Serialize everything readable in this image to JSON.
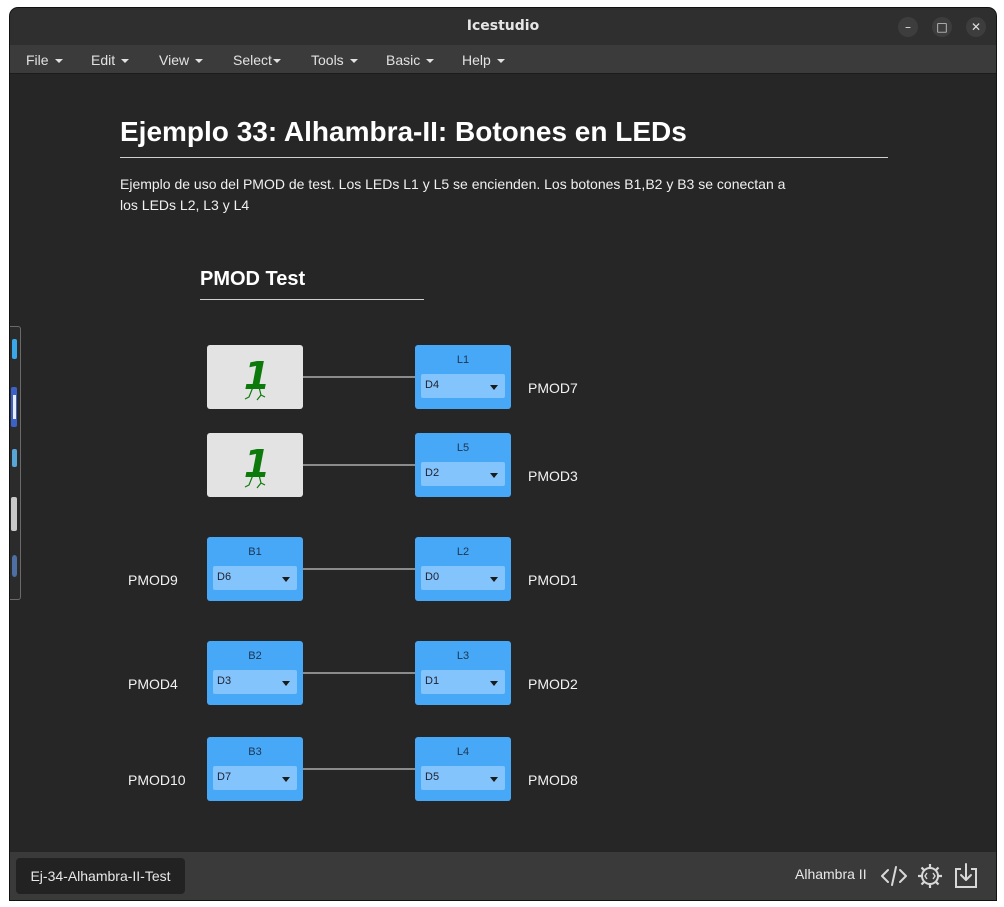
{
  "window": {
    "title": "Icestudio"
  },
  "menubar": {
    "items": [
      "File",
      "Edit",
      "View",
      "Select",
      "Tools",
      "Basic",
      "Help"
    ]
  },
  "doc": {
    "title": "Ejemplo 33: Alhambra-II: Botones en LEDs",
    "description": "Ejemplo de uso del PMOD de test. Los LEDs L1 y L5 se encienden. Los botones B1,B2 y B3 se conectan a los LEDs L2, L3 y L4",
    "subtitle": "PMOD Test"
  },
  "constants": [
    {
      "value": "1"
    },
    {
      "value": "1"
    }
  ],
  "inputs": [
    {
      "name": "B1",
      "pin": "D6",
      "label": "PMOD9"
    },
    {
      "name": "B2",
      "pin": "D3",
      "label": "PMOD4"
    },
    {
      "name": "B3",
      "pin": "D7",
      "label": "PMOD10"
    }
  ],
  "outputs": [
    {
      "name": "L1",
      "pin": "D4",
      "label": "PMOD7"
    },
    {
      "name": "L5",
      "pin": "D2",
      "label": "PMOD3"
    },
    {
      "name": "L2",
      "pin": "D0",
      "label": "PMOD1"
    },
    {
      "name": "L3",
      "pin": "D1",
      "label": "PMOD2"
    },
    {
      "name": "L4",
      "pin": "D5",
      "label": "PMOD8"
    }
  ],
  "footer": {
    "tab": "Ej-34-Alhambra-II-Test",
    "board": "Alhambra II",
    "icons": [
      "code-icon",
      "gear-code-icon",
      "download-icon"
    ]
  }
}
